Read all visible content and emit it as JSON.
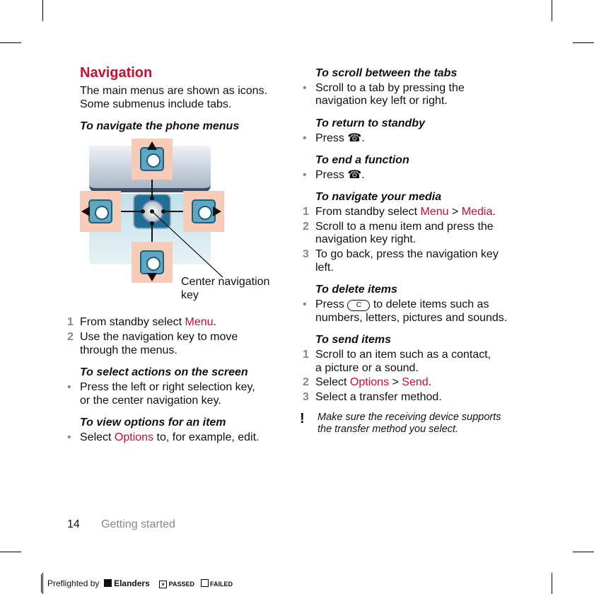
{
  "left": {
    "title": "Navigation",
    "intro": [
      "The main menus are shown as icons.",
      "Some submenus include tabs."
    ],
    "h_navigate": "To navigate the phone menus",
    "callout": [
      "Center navigation",
      "key"
    ],
    "steps": [
      {
        "n": "1",
        "pre": "From standby select ",
        "link": "Menu",
        "post": "."
      },
      {
        "n": "2",
        "lines": [
          "Use the navigation key to move",
          "through the menus."
        ]
      }
    ],
    "h_select": "To select actions on the screen",
    "select_bullet": [
      "Press the left or right selection key,",
      "or the center navigation key."
    ],
    "h_options": "To view options for an item",
    "options_bullet": {
      "pre": "Select ",
      "link": "Options",
      "post": " to, for example, edit."
    }
  },
  "right": {
    "h_tabs": "To scroll between the tabs",
    "tabs_bullet": [
      "Scroll to a tab by pressing the",
      "navigation key left or right."
    ],
    "h_standby": "To return to standby",
    "standby_bullet": "Press",
    "h_end": "To end a function",
    "end_bullet": "Press",
    "h_media": "To navigate your media",
    "media_steps": [
      {
        "n": "1",
        "pre": "From standby select ",
        "link1": "Menu",
        "sep": " > ",
        "link2": "Media",
        "post": "."
      },
      {
        "n": "2",
        "lines": [
          "Scroll to a menu item and press the",
          "navigation key right."
        ]
      },
      {
        "n": "3",
        "lines": [
          "To go back, press the navigation key",
          "left."
        ]
      }
    ],
    "h_delete": "To delete items",
    "delete_bullet": {
      "pre": "Press",
      "key": "C",
      "post": "to delete items such as",
      "line2": "numbers, letters, pictures and sounds."
    },
    "h_send": "To send items",
    "send_steps": [
      {
        "n": "1",
        "lines": [
          "Scroll to an item such as a contact,",
          "a picture or a sound."
        ]
      },
      {
        "n": "2",
        "pre": "Select ",
        "link1": "Options",
        "sep": " > ",
        "link2": "Send",
        "post": "."
      },
      {
        "n": "3",
        "text": "Select a transfer method."
      }
    ],
    "note": [
      "Make sure the receiving device supports",
      "the transfer method you select."
    ]
  },
  "footer": {
    "page": "14",
    "section": "Getting started"
  },
  "preflight": {
    "label": "Preflighted by",
    "brand": "Elanders",
    "passed": "PASSED",
    "failed": "FAILED"
  },
  "bullet": "•",
  "colors": {
    "link": "#c8102e",
    "key_bg": "#f6cbb7",
    "key_blue": "#5fa6c3"
  }
}
